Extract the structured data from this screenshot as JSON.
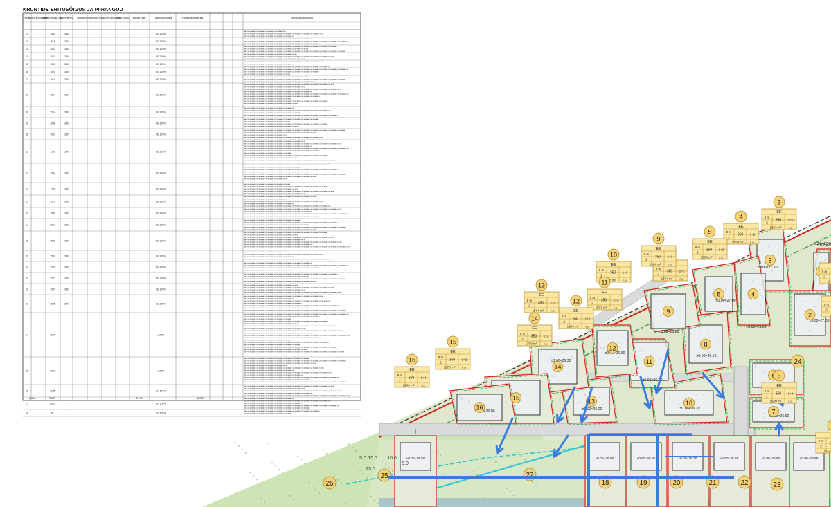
{
  "table": {
    "title": "KRUNTIDE EHITUSÕIGUS JA PIIRANGUD",
    "header": {
      "pos": "Pos. nr",
      "area_legal": "Krundi sihtotstarve",
      "area": "Krundi pindala (m²)",
      "max_bld": "Hoonete arv",
      "floors": "Hoone korruselisus",
      "ehf": "Ehitusalune pind (m²)",
      "height": "Hoone kõrgus",
      "roof": "Katuse kalle",
      "fire": "Tulepüsivus klass",
      "parking": "Parkimiskohtade arv",
      "notes": "Servituudid/piirangud"
    },
    "rows": [
      {
        "nr": "1",
        "area": "1534",
        "ehf": "350",
        "note": "EE 100%"
      },
      {
        "nr": "2",
        "area": "1518",
        "ehf": "350",
        "note": "EE 100%"
      },
      {
        "nr": "3",
        "area": "1503",
        "ehf": "350",
        "note": "EE 100%"
      },
      {
        "nr": "4",
        "area": "1510",
        "ehf": "350",
        "note": "EE 100%"
      },
      {
        "nr": "5",
        "area": "1500",
        "ehf": "350",
        "note": "EE 100%"
      },
      {
        "nr": "6",
        "area": "1520",
        "ehf": "350",
        "note": "EE 100%"
      },
      {
        "nr": "7",
        "area": "1514",
        "ehf": "350",
        "note": "EE 100%"
      },
      {
        "nr": "8",
        "area": "1644",
        "ehf": "350",
        "note": "EE 100%"
      },
      {
        "nr": "9",
        "area": "1514",
        "ehf": "350",
        "note": "EE 100%"
      },
      {
        "nr": "10",
        "area": "1648",
        "ehf": "350",
        "note": "EE 100%"
      },
      {
        "nr": "11",
        "area": "1503",
        "ehf": "350",
        "note": "EE 100%"
      },
      {
        "nr": "12",
        "area": "1509",
        "ehf": "350",
        "note": "EE 100%"
      },
      {
        "nr": "13",
        "area": "1504",
        "ehf": "350",
        "note": "EE 100%"
      },
      {
        "nr": "14",
        "area": "1700",
        "ehf": "350",
        "note": "EE 100%"
      },
      {
        "nr": "15",
        "area": "1670",
        "ehf": "350",
        "note": "EE 100%"
      },
      {
        "nr": "16",
        "area": "1649",
        "ehf": "350",
        "note": "EE 100%"
      },
      {
        "nr": "17",
        "area": "1517",
        "ehf": "350",
        "note": "EE 100%"
      },
      {
        "nr": "18",
        "area": "1582",
        "ehf": "350",
        "note": "EE 100%"
      },
      {
        "nr": "19",
        "area": "1582",
        "ehf": "350",
        "note": "EE 100%"
      },
      {
        "nr": "20",
        "area": "1567",
        "ehf": "350",
        "note": "EE 100%"
      },
      {
        "nr": "21",
        "area": "1513",
        "ehf": "350",
        "note": "EE 100%"
      },
      {
        "nr": "22",
        "area": "1524",
        "ehf": "350",
        "note": "EE 100%"
      },
      {
        "nr": "23",
        "area": "1585",
        "ehf": "350",
        "note": "EE 100%"
      },
      {
        "nr": "24",
        "area": "3679",
        "ehf": "-",
        "note": "L 100%"
      },
      {
        "nr": "25",
        "area": "3800",
        "ehf": "-",
        "note": "L 100%"
      },
      {
        "nr": "26",
        "area": "3845",
        "ehf": "-",
        "note": "Üm 100%"
      },
      {
        "nr": "27",
        "area": "10021",
        "ehf": "-",
        "note": "Üm 100%"
      },
      {
        "nr": "28",
        "area": "61",
        "ehf": "-",
        "note": "Tm 100%"
      }
    ],
    "footer": {
      "label": "Kokku",
      "area_total": "52617",
      "ehf_total": "23×40",
      "sum2": "15050"
    }
  },
  "plan": {
    "lots": [
      {
        "nr": "1",
        "zone": "EE",
        "floors": "2",
        "ehf": "350",
        "height": "9 m",
        "area": "1534 m²",
        "extra": "1÷2",
        "elev": "±0.00=27.00"
      },
      {
        "nr": "2",
        "zone": "EE",
        "floors": "2",
        "ehf": "350",
        "height": "9 m",
        "area": "1518 m²",
        "extra": "1÷2",
        "elev": "±0.00=27.00"
      },
      {
        "nr": "3",
        "zone": "EE",
        "floors": "2",
        "ehf": "350",
        "height": "9 m",
        "area": "1503 m²",
        "extra": "1÷2",
        "elev": "±0.00=27.10"
      },
      {
        "nr": "4",
        "zone": "EE",
        "floors": "2",
        "ehf": "350",
        "height": "9 m",
        "area": "1510 m²",
        "extra": "1÷2",
        "elev": "±0.00=26.80"
      },
      {
        "nr": "5",
        "zone": "EE",
        "floors": "2",
        "ehf": "350",
        "height": "9 m",
        "area": "1500 m²",
        "extra": "1÷2",
        "elev": "±0.00=27.00"
      },
      {
        "nr": "6",
        "zone": "EE",
        "floors": "2",
        "ehf": "350",
        "height": "9 m",
        "area": "1520 m²",
        "extra": "1÷2",
        "elev": "±0.00=26.90"
      },
      {
        "nr": "7",
        "zone": "EE",
        "floors": "2",
        "ehf": "350",
        "height": "9 m",
        "area": "1514 m²",
        "extra": "1÷2",
        "elev": "±0.00=26.60"
      },
      {
        "nr": "8",
        "zone": "EE",
        "floors": "2",
        "ehf": "350",
        "height": "9 m",
        "area": "1644 m²",
        "extra": "1÷2",
        "elev": "±0.00=26.50"
      },
      {
        "nr": "9",
        "zone": "EE",
        "floors": "2",
        "ehf": "350",
        "height": "9 m",
        "area": "1514 m²",
        "extra": "1÷2",
        "elev": "±0.00=26.80"
      },
      {
        "nr": "10",
        "zone": "EE",
        "floors": "2",
        "ehf": "350",
        "height": "9 m",
        "area": "1648 m²",
        "extra": "1÷2",
        "elev": "±0.00=26.20"
      },
      {
        "nr": "11",
        "zone": "EE",
        "floors": "2",
        "ehf": "350",
        "height": "9 m",
        "area": "1503 m²",
        "extra": "1÷2",
        "elev": "±0.00=26.40"
      },
      {
        "nr": "12",
        "zone": "EE",
        "floors": "2",
        "ehf": "350",
        "height": "9 m",
        "area": "1509 m²",
        "extra": "1÷2",
        "elev": "±0.00=26.60"
      },
      {
        "nr": "13",
        "zone": "EE",
        "floors": "2",
        "ehf": "350",
        "height": "9 m",
        "area": "1504 m²",
        "extra": "1÷2",
        "elev": "±0.00=26.00"
      },
      {
        "nr": "14",
        "zone": "EE",
        "floors": "2",
        "ehf": "350",
        "height": "9 m",
        "area": "1700 m²",
        "extra": "1÷2",
        "elev": "±0.00=26.30"
      },
      {
        "nr": "15",
        "zone": "EE",
        "floors": "2",
        "ehf": "350",
        "height": "9 m",
        "area": "1670 m²",
        "extra": "1÷2",
        "elev": ""
      },
      {
        "nr": "16",
        "zone": "EE",
        "floors": "2",
        "ehf": "350",
        "height": "9 m",
        "area": "1649 m²",
        "extra": "1÷2",
        "elev": "±0.00=26.00"
      }
    ],
    "bottom_labels": [
      "25",
      "26",
      "27",
      "18",
      "19",
      "20",
      "21",
      "22",
      "23",
      "24"
    ],
    "row_elev": [
      "±0.00=25.50",
      "±0.00=26.00",
      "±0.00=26.30",
      "±0.00=26.30",
      "±0.00=26.35",
      "±0.00=26.60",
      "±0.00=26.65"
    ],
    "dims": [
      "5.0",
      "15.0",
      "10.0",
      "5.0",
      "25.0"
    ],
    "misc": {
      "np": "n.p.",
      "side_elev": "±0.00=27"
    }
  },
  "colors": {
    "lot_fill": "#e6ebd9",
    "green_strip": "#cfe6b8",
    "boundary_red": "#d0261c",
    "label_fill": "#f6d37a",
    "label_stroke": "#b38a20",
    "arrow_blue": "#3a7be0",
    "water_cyan": "#32c6d8",
    "road_gray": "#d8dadb"
  }
}
